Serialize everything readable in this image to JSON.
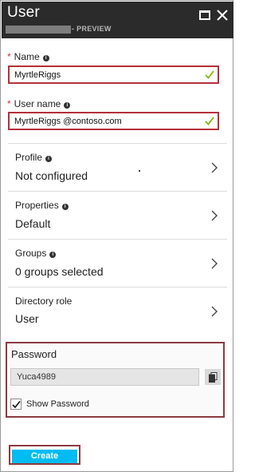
{
  "header": {
    "title": "User",
    "subtitle": "- PREVIEW",
    "maximize_icon": "maximize-icon",
    "close_icon": "close-icon"
  },
  "fields": {
    "name": {
      "label": "Name",
      "required": "*",
      "value": "MyrtleRiggs",
      "info_icon": "info-icon",
      "status_icon": "checkmark-icon"
    },
    "username": {
      "label": "User name",
      "required": "*",
      "value": "MyrtleRiggs @contoso.com",
      "info_icon": "info-icon",
      "status_icon": "checkmark-icon"
    }
  },
  "nav_rows": [
    {
      "label": "Profile",
      "value": "Not configured",
      "has_info": true
    },
    {
      "label": "Properties",
      "value": "Default",
      "has_info": true
    },
    {
      "label": "Groups",
      "value": "0 groups selected",
      "has_info": true
    },
    {
      "label": "Directory role",
      "value": "User",
      "has_info": false
    }
  ],
  "password": {
    "label": "Password",
    "value": "Yuca4989",
    "copy_icon": "copy-icon",
    "show_label": "Show Password",
    "show_checked": true
  },
  "actions": {
    "create_label": "Create"
  },
  "colors": {
    "header_bg": "#2b2b2b",
    "highlight_border": "#b4303a",
    "button_bg": "#00bcf2",
    "check_green": "#7fba00",
    "required_red": "#d13438"
  }
}
